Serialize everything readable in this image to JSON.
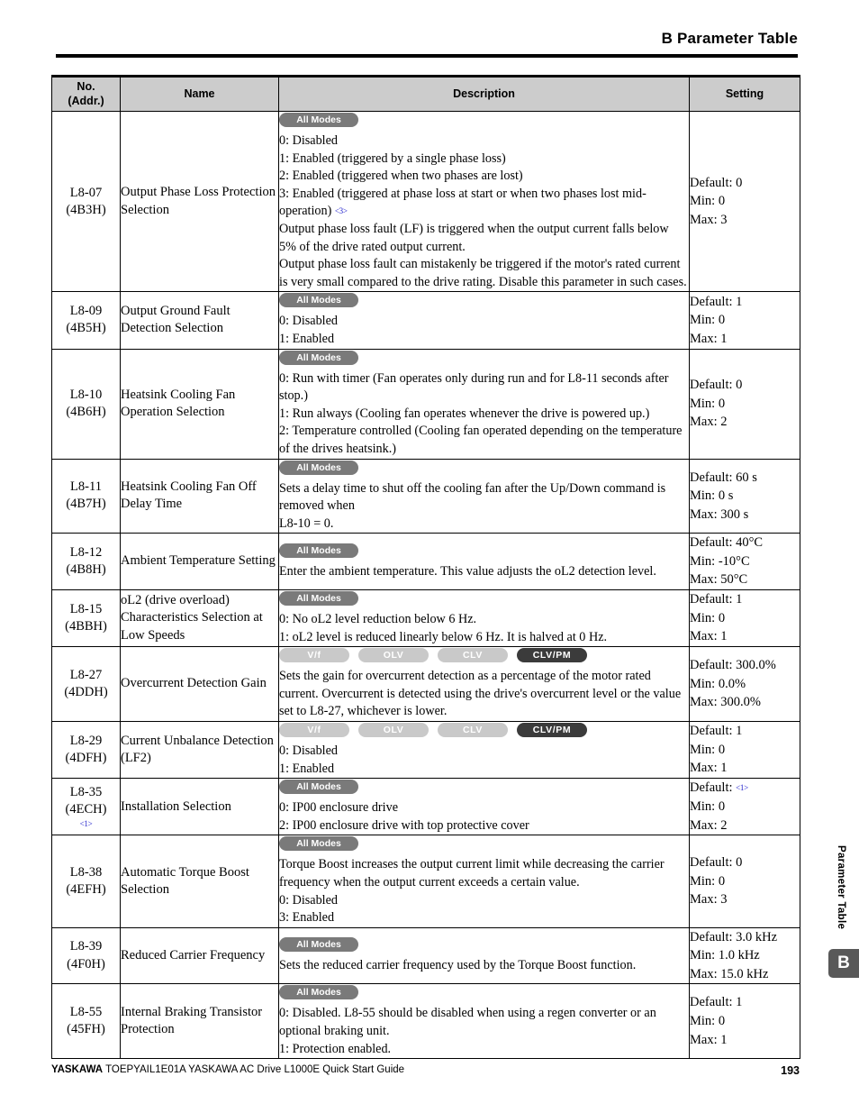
{
  "header": {
    "title": "B  Parameter Table"
  },
  "side_tab": {
    "label": "Parameter Table",
    "badge": "B"
  },
  "footer": {
    "brand": "YASKAWA",
    "text": " TOEPYAIL1E01A YASKAWA AC Drive L1000E Quick Start Guide",
    "page": "193"
  },
  "table": {
    "columns": {
      "no": "No.\n(Addr.)",
      "no_line1": "No.",
      "no_line2": "(Addr.)",
      "name": "Name",
      "description": "Description",
      "setting": "Setting"
    },
    "badge_labels": {
      "all_modes": "All Modes",
      "vf": "V/f",
      "olv": "OLV",
      "clv": "CLV",
      "clvpm": "CLV/PM"
    },
    "rows": [
      {
        "no": "L8-07",
        "addr": "(4B3H)",
        "footnote_no": "",
        "name": "Output Phase Loss Protection Selection",
        "badge_type": "all",
        "desc_lines": [
          "0: Disabled",
          "1: Enabled (triggered by a single phase loss)",
          "2: Enabled (triggered when two phases are lost)",
          "3: Enabled (triggered at phase loss at start or when two phases lost mid-operation) <3>",
          "Output phase loss fault (LF) is triggered when the output current falls below 5% of the drive rated output current.",
          "Output phase loss fault can mistakenly be triggered if the motor's rated current is very small compared to the drive rating. Disable this parameter in such cases."
        ],
        "setting": [
          "Default: 0",
          "Min: 0",
          "Max: 3"
        ],
        "setting_footnote": ""
      },
      {
        "no": "L8-09",
        "addr": "(4B5H)",
        "footnote_no": "",
        "name": "Output Ground Fault Detection Selection",
        "badge_type": "all",
        "desc_lines": [
          "0: Disabled",
          "1: Enabled"
        ],
        "setting": [
          "Default: 1",
          "Min: 0",
          "Max: 1"
        ],
        "setting_footnote": ""
      },
      {
        "no": "L8-10",
        "addr": "(4B6H)",
        "footnote_no": "",
        "name": "Heatsink Cooling Fan Operation Selection",
        "badge_type": "all",
        "desc_lines": [
          "0: Run with timer (Fan operates only during run and for L8-11 seconds after stop.)",
          "1: Run always (Cooling fan operates whenever the drive is powered up.)",
          "2: Temperature controlled (Cooling fan operated depending on the temperature of the drives heatsink.)"
        ],
        "setting": [
          "Default: 0",
          "Min: 0",
          "Max: 2"
        ],
        "setting_footnote": ""
      },
      {
        "no": "L8-11",
        "addr": "(4B7H)",
        "footnote_no": "",
        "name": "Heatsink Cooling Fan Off Delay Time",
        "badge_type": "all",
        "desc_lines": [
          "Sets a delay time to shut off the cooling fan after the Up/Down command is removed when",
          "L8-10 = 0."
        ],
        "setting": [
          "Default: 60 s",
          "Min: 0 s",
          "Max: 300 s"
        ],
        "setting_footnote": ""
      },
      {
        "no": "L8-12",
        "addr": "(4B8H)",
        "footnote_no": "",
        "name": "Ambient Temperature Setting",
        "badge_type": "all",
        "desc_lines": [
          "Enter the ambient temperature. This value adjusts the oL2 detection level."
        ],
        "setting": [
          "Default: 40°C",
          "Min: -10°C",
          "Max: 50°C"
        ],
        "setting_footnote": ""
      },
      {
        "no": "L8-15",
        "addr": "(4BBH)",
        "footnote_no": "",
        "name": "oL2 (drive overload) Characteristics Selection at Low Speeds",
        "badge_type": "all",
        "desc_lines": [
          "0: No oL2 level reduction below 6 Hz.",
          "1: oL2 level is reduced linearly below 6 Hz. It is halved at 0 Hz."
        ],
        "setting": [
          "Default: 1",
          "Min: 0",
          "Max: 1"
        ],
        "setting_footnote": ""
      },
      {
        "no": "L8-27",
        "addr": "(4DDH)",
        "footnote_no": "",
        "name": "Overcurrent Detection Gain",
        "badge_type": "modes",
        "modes": [
          {
            "label": "V/f",
            "active": false
          },
          {
            "label": "OLV",
            "active": false
          },
          {
            "label": "CLV",
            "active": false
          },
          {
            "label": "CLV/PM",
            "active": true
          }
        ],
        "desc_lines": [
          "Sets the gain for overcurrent detection as a percentage of the motor rated current. Overcurrent is detected using the drive's overcurrent level or the value set to L8-27, whichever is lower."
        ],
        "setting": [
          "Default: 300.0%",
          "Min: 0.0%",
          "Max: 300.0%"
        ],
        "setting_footnote": ""
      },
      {
        "no": "L8-29",
        "addr": "(4DFH)",
        "footnote_no": "",
        "name": "Current Unbalance Detection (LF2)",
        "badge_type": "modes",
        "modes": [
          {
            "label": "V/f",
            "active": false
          },
          {
            "label": "OLV",
            "active": false
          },
          {
            "label": "CLV",
            "active": false
          },
          {
            "label": "CLV/PM",
            "active": true
          }
        ],
        "desc_lines": [
          "0: Disabled",
          "1: Enabled"
        ],
        "setting": [
          "Default: 1",
          "Min: 0",
          "Max: 1"
        ],
        "setting_footnote": ""
      },
      {
        "no": "L8-35",
        "addr": "(4ECH)",
        "footnote_no": "<1>",
        "name": "Installation Selection",
        "badge_type": "all",
        "desc_lines": [
          "0: IP00 enclosure drive",
          "2: IP00 enclosure drive with top protective cover"
        ],
        "setting": [
          "Default: ",
          "Min: 0",
          "Max: 2"
        ],
        "setting_footnote": "<1>"
      },
      {
        "no": "L8-38",
        "addr": "(4EFH)",
        "footnote_no": "",
        "name": "Automatic Torque Boost Selection",
        "badge_type": "all",
        "desc_lines": [
          "Torque Boost increases the output current limit while decreasing the carrier frequency when the output current exceeds a certain value.",
          "0: Disabled",
          "3: Enabled"
        ],
        "setting": [
          "Default: 0",
          "Min: 0",
          "Max: 3"
        ],
        "setting_footnote": ""
      },
      {
        "no": "L8-39",
        "addr": "(4F0H)",
        "footnote_no": "",
        "name": "Reduced Carrier Frequency",
        "badge_type": "all",
        "desc_lines": [
          "Sets the reduced carrier frequency used by the Torque Boost function."
        ],
        "setting": [
          "Default: 3.0 kHz",
          "Min: 1.0 kHz",
          "Max: 15.0 kHz"
        ],
        "setting_footnote": ""
      },
      {
        "no": "L8-55",
        "addr": "(45FH)",
        "footnote_no": "",
        "name": "Internal Braking Transistor Protection",
        "badge_type": "all",
        "desc_lines": [
          "0: Disabled. L8-55 should be disabled when using a regen converter or an optional braking unit.",
          "1: Protection enabled."
        ],
        "setting": [
          "Default: 1",
          "Min: 0",
          "Max: 1"
        ],
        "setting_footnote": ""
      }
    ]
  }
}
